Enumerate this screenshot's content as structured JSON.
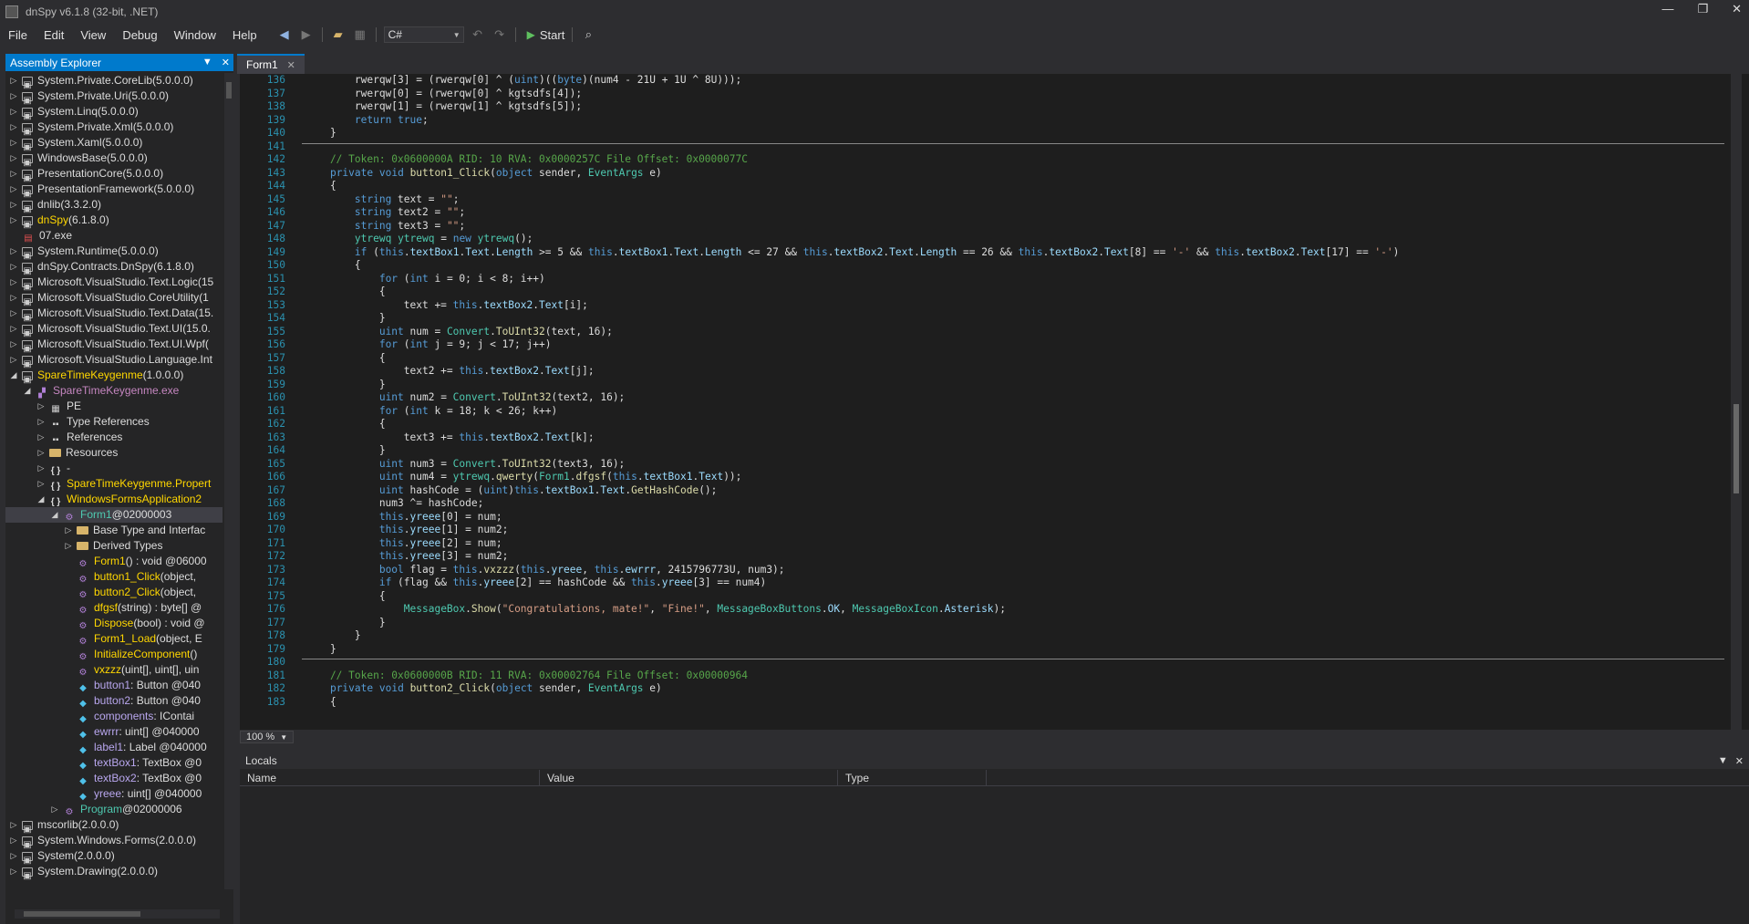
{
  "window": {
    "title": "dnSpy v6.1.8 (32-bit, .NET)",
    "controls": [
      "—",
      "❐",
      "✕"
    ]
  },
  "menu": [
    "File",
    "Edit",
    "View",
    "Debug",
    "Window",
    "Help"
  ],
  "toolbar": {
    "language": "C#",
    "start_label": "Start"
  },
  "assembly_explorer": {
    "title": "Assembly Explorer",
    "nodes": [
      {
        "depth": 0,
        "exp": "▷",
        "icon": "asm",
        "label": "System.Private.CoreLib",
        "ver": " (5.0.0.0)",
        "style": ""
      },
      {
        "depth": 0,
        "exp": "▷",
        "icon": "asm",
        "label": "System.Private.Uri",
        "ver": " (5.0.0.0)",
        "style": ""
      },
      {
        "depth": 0,
        "exp": "▷",
        "icon": "asm",
        "label": "System.Linq",
        "ver": " (5.0.0.0)",
        "style": ""
      },
      {
        "depth": 0,
        "exp": "▷",
        "icon": "asm",
        "label": "System.Private.Xml",
        "ver": " (5.0.0.0)",
        "style": ""
      },
      {
        "depth": 0,
        "exp": "▷",
        "icon": "asm",
        "label": "System.Xaml",
        "ver": " (5.0.0.0)",
        "style": ""
      },
      {
        "depth": 0,
        "exp": "▷",
        "icon": "asm",
        "label": "WindowsBase",
        "ver": " (5.0.0.0)",
        "style": ""
      },
      {
        "depth": 0,
        "exp": "▷",
        "icon": "asm",
        "label": "PresentationCore",
        "ver": " (5.0.0.0)",
        "style": ""
      },
      {
        "depth": 0,
        "exp": "▷",
        "icon": "asm",
        "label": "PresentationFramework",
        "ver": " (5.0.0.0)",
        "style": ""
      },
      {
        "depth": 0,
        "exp": "▷",
        "icon": "asm",
        "label": "dnlib",
        "ver": " (3.3.2.0)",
        "style": ""
      },
      {
        "depth": 0,
        "exp": "▷",
        "icon": "asm",
        "label": "dnSpy",
        "ver": " (6.1.8.0)",
        "style": "yellow"
      },
      {
        "depth": 0,
        "exp": "",
        "icon": "exe",
        "label": "07.exe",
        "ver": "",
        "style": ""
      },
      {
        "depth": 0,
        "exp": "▷",
        "icon": "asm",
        "label": "System.Runtime",
        "ver": " (5.0.0.0)",
        "style": ""
      },
      {
        "depth": 0,
        "exp": "▷",
        "icon": "asm",
        "label": "dnSpy.Contracts.DnSpy",
        "ver": " (6.1.8.0)",
        "style": ""
      },
      {
        "depth": 0,
        "exp": "▷",
        "icon": "asm",
        "label": "Microsoft.VisualStudio.Text.Logic",
        "ver": " (15",
        "style": ""
      },
      {
        "depth": 0,
        "exp": "▷",
        "icon": "asm",
        "label": "Microsoft.VisualStudio.CoreUtility",
        "ver": " (1",
        "style": ""
      },
      {
        "depth": 0,
        "exp": "▷",
        "icon": "asm",
        "label": "Microsoft.VisualStudio.Text.Data",
        "ver": " (15.",
        "style": ""
      },
      {
        "depth": 0,
        "exp": "▷",
        "icon": "asm",
        "label": "Microsoft.VisualStudio.Text.UI",
        "ver": " (15.0.",
        "style": ""
      },
      {
        "depth": 0,
        "exp": "▷",
        "icon": "asm",
        "label": "Microsoft.VisualStudio.Text.UI.Wpf",
        "ver": " (",
        "style": ""
      },
      {
        "depth": 0,
        "exp": "▷",
        "icon": "asm",
        "label": "Microsoft.VisualStudio.Language.Int",
        "ver": "",
        "style": ""
      },
      {
        "depth": 0,
        "exp": "◢",
        "icon": "asm",
        "label": "SpareTimeKeygenme",
        "ver": " (1.0.0.0)",
        "style": "yellow"
      },
      {
        "depth": 1,
        "exp": "◢",
        "icon": "module",
        "label": "SpareTimeKeygenme.exe",
        "ver": "",
        "style": "purple"
      },
      {
        "depth": 2,
        "exp": "▷",
        "icon": "pe",
        "label": "PE",
        "ver": "",
        "style": ""
      },
      {
        "depth": 2,
        "exp": "▷",
        "icon": "ref",
        "label": "Type References",
        "ver": "",
        "style": ""
      },
      {
        "depth": 2,
        "exp": "▷",
        "icon": "ref",
        "label": "References",
        "ver": "",
        "style": ""
      },
      {
        "depth": 2,
        "exp": "▷",
        "icon": "folder",
        "label": "Resources",
        "ver": "",
        "style": ""
      },
      {
        "depth": 2,
        "exp": "▷",
        "icon": "ns",
        "label": "-",
        "ver": "",
        "style": ""
      },
      {
        "depth": 2,
        "exp": "▷",
        "icon": "ns",
        "label": "SpareTimeKeygenme.Propert",
        "ver": "",
        "style": "yellow"
      },
      {
        "depth": 2,
        "exp": "◢",
        "icon": "ns",
        "label": "WindowsFormsApplication2",
        "ver": "",
        "style": "yellow"
      },
      {
        "depth": 3,
        "exp": "◢",
        "icon": "class",
        "label": "Form1",
        "ver": " @02000003",
        "style": "sel"
      },
      {
        "depth": 4,
        "exp": "▷",
        "icon": "folder",
        "label": "Base Type and Interfac",
        "ver": "",
        "style": ""
      },
      {
        "depth": 4,
        "exp": "▷",
        "icon": "folder",
        "label": "Derived Types",
        "ver": "",
        "style": ""
      },
      {
        "depth": 4,
        "exp": "",
        "icon": "meth",
        "label": "Form1",
        "ver": "() : void @06000",
        "style": "m"
      },
      {
        "depth": 4,
        "exp": "",
        "icon": "meth",
        "label": "button1_Click",
        "ver": "(object,",
        "style": "m"
      },
      {
        "depth": 4,
        "exp": "",
        "icon": "meth",
        "label": "button2_Click",
        "ver": "(object,",
        "style": "m"
      },
      {
        "depth": 4,
        "exp": "",
        "icon": "meth",
        "label": "dfgsf",
        "ver": "(string) : byte[] @",
        "style": "m"
      },
      {
        "depth": 4,
        "exp": "",
        "icon": "meth",
        "label": "Dispose",
        "ver": "(bool) : void @",
        "style": "m"
      },
      {
        "depth": 4,
        "exp": "",
        "icon": "meth",
        "label": "Form1_Load",
        "ver": "(object, E",
        "style": "m"
      },
      {
        "depth": 4,
        "exp": "",
        "icon": "meth",
        "label": "InitializeComponent",
        "ver": "()",
        "style": "m"
      },
      {
        "depth": 4,
        "exp": "",
        "icon": "meth",
        "label": "vxzzz",
        "ver": "(uint[], uint[], uin",
        "style": "m"
      },
      {
        "depth": 4,
        "exp": "",
        "icon": "field",
        "label": "button1",
        "ver": " : Button @040",
        "style": "f"
      },
      {
        "depth": 4,
        "exp": "",
        "icon": "field",
        "label": "button2",
        "ver": " : Button @040",
        "style": "f"
      },
      {
        "depth": 4,
        "exp": "",
        "icon": "field",
        "label": "components",
        "ver": " : IContai",
        "style": "f"
      },
      {
        "depth": 4,
        "exp": "",
        "icon": "field",
        "label": "ewrrr",
        "ver": " : uint[] @040000",
        "style": "f"
      },
      {
        "depth": 4,
        "exp": "",
        "icon": "field",
        "label": "label1",
        "ver": " : Label @040000",
        "style": "f"
      },
      {
        "depth": 4,
        "exp": "",
        "icon": "field",
        "label": "textBox1",
        "ver": " : TextBox @0",
        "style": "f"
      },
      {
        "depth": 4,
        "exp": "",
        "icon": "field",
        "label": "textBox2",
        "ver": " : TextBox @0",
        "style": "f"
      },
      {
        "depth": 4,
        "exp": "",
        "icon": "field",
        "label": "yreee",
        "ver": " : uint[] @040000",
        "style": "f"
      },
      {
        "depth": 3,
        "exp": "▷",
        "icon": "class",
        "label": "Program",
        "ver": " @02000006",
        "style": "prog"
      },
      {
        "depth": 0,
        "exp": "▷",
        "icon": "asm",
        "label": "mscorlib",
        "ver": " (2.0.0.0)",
        "style": ""
      },
      {
        "depth": 0,
        "exp": "▷",
        "icon": "asm",
        "label": "System.Windows.Forms",
        "ver": " (2.0.0.0)",
        "style": ""
      },
      {
        "depth": 0,
        "exp": "▷",
        "icon": "asm",
        "label": "System",
        "ver": " (2.0.0.0)",
        "style": ""
      },
      {
        "depth": 0,
        "exp": "▷",
        "icon": "asm",
        "label": "System.Drawing",
        "ver": " (2.0.0.0)",
        "style": ""
      }
    ]
  },
  "tabs": [
    {
      "label": "Form1"
    }
  ],
  "code_lines": [
    {
      "n": "136",
      "t": "        rwerqw[3] = (rwerqw[0] ^ (uint)((byte)(num4 - 21U + 1U ^ 8U)));"
    },
    {
      "n": "137",
      "t": "        rwerqw[0] = (rwerqw[0] ^ kgtsdfs[4]);"
    },
    {
      "n": "138",
      "t": "        rwerqw[1] = (rwerqw[1] ^ kgtsdfs[5]);"
    },
    {
      "n": "139",
      "t": "        return true;"
    },
    {
      "n": "140",
      "t": "    }"
    },
    {
      "n": "141",
      "t": ""
    },
    {
      "n": "142",
      "t": "    // Token: 0x0600000A RID: 10 RVA: 0x0000257C File Offset: 0x0000077C"
    },
    {
      "n": "143",
      "t": "    private void button1_Click(object sender, EventArgs e)"
    },
    {
      "n": "144",
      "t": "    {"
    },
    {
      "n": "145",
      "t": "        string text = \"\";"
    },
    {
      "n": "146",
      "t": "        string text2 = \"\";"
    },
    {
      "n": "147",
      "t": "        string text3 = \"\";"
    },
    {
      "n": "148",
      "t": "        ytrewq ytrewq = new ytrewq();"
    },
    {
      "n": "149",
      "t": "        if (this.textBox1.Text.Length >= 5 && this.textBox1.Text.Length <= 27 && this.textBox2.Text.Length == 26 && this.textBox2.Text[8] == '-' && this.textBox2.Text[17] == '-')"
    },
    {
      "n": "150",
      "t": "        {"
    },
    {
      "n": "151",
      "t": "            for (int i = 0; i < 8; i++)"
    },
    {
      "n": "152",
      "t": "            {"
    },
    {
      "n": "153",
      "t": "                text += this.textBox2.Text[i];"
    },
    {
      "n": "154",
      "t": "            }"
    },
    {
      "n": "155",
      "t": "            uint num = Convert.ToUInt32(text, 16);"
    },
    {
      "n": "156",
      "t": "            for (int j = 9; j < 17; j++)"
    },
    {
      "n": "157",
      "t": "            {"
    },
    {
      "n": "158",
      "t": "                text2 += this.textBox2.Text[j];"
    },
    {
      "n": "159",
      "t": "            }"
    },
    {
      "n": "160",
      "t": "            uint num2 = Convert.ToUInt32(text2, 16);"
    },
    {
      "n": "161",
      "t": "            for (int k = 18; k < 26; k++)"
    },
    {
      "n": "162",
      "t": "            {"
    },
    {
      "n": "163",
      "t": "                text3 += this.textBox2.Text[k];"
    },
    {
      "n": "164",
      "t": "            }"
    },
    {
      "n": "165",
      "t": "            uint num3 = Convert.ToUInt32(text3, 16);"
    },
    {
      "n": "166",
      "t": "            uint num4 = ytrewq.qwerty(Form1.dfgsf(this.textBox1.Text));"
    },
    {
      "n": "167",
      "t": "            uint hashCode = (uint)this.textBox1.Text.GetHashCode();"
    },
    {
      "n": "168",
      "t": "            num3 ^= hashCode;"
    },
    {
      "n": "169",
      "t": "            this.yreee[0] = num;"
    },
    {
      "n": "170",
      "t": "            this.yreee[1] = num2;"
    },
    {
      "n": "171",
      "t": "            this.yreee[2] = num;"
    },
    {
      "n": "172",
      "t": "            this.yreee[3] = num2;"
    },
    {
      "n": "173",
      "t": "            bool flag = this.vxzzz(this.yreee, this.ewrrr, 2415796773U, num3);"
    },
    {
      "n": "174",
      "t": "            if (flag && this.yreee[2] == hashCode && this.yreee[3] == num4)"
    },
    {
      "n": "175",
      "t": "            {"
    },
    {
      "n": "176",
      "t": "                MessageBox.Show(\"Congratulations, mate!\", \"Fine!\", MessageBoxButtons.OK, MessageBoxIcon.Asterisk);"
    },
    {
      "n": "177",
      "t": "            }"
    },
    {
      "n": "178",
      "t": "        }"
    },
    {
      "n": "179",
      "t": "    }"
    },
    {
      "n": "180",
      "t": ""
    },
    {
      "n": "181",
      "t": "    // Token: 0x0600000B RID: 11 RVA: 0x00002764 File Offset: 0x00000964"
    },
    {
      "n": "182",
      "t": "    private void button2_Click(object sender, EventArgs e)"
    },
    {
      "n": "183",
      "t": "    {"
    }
  ],
  "editor": {
    "zoom": "100 %"
  },
  "locals": {
    "title": "Locals",
    "columns": [
      "Name",
      "Value",
      "Type"
    ]
  }
}
